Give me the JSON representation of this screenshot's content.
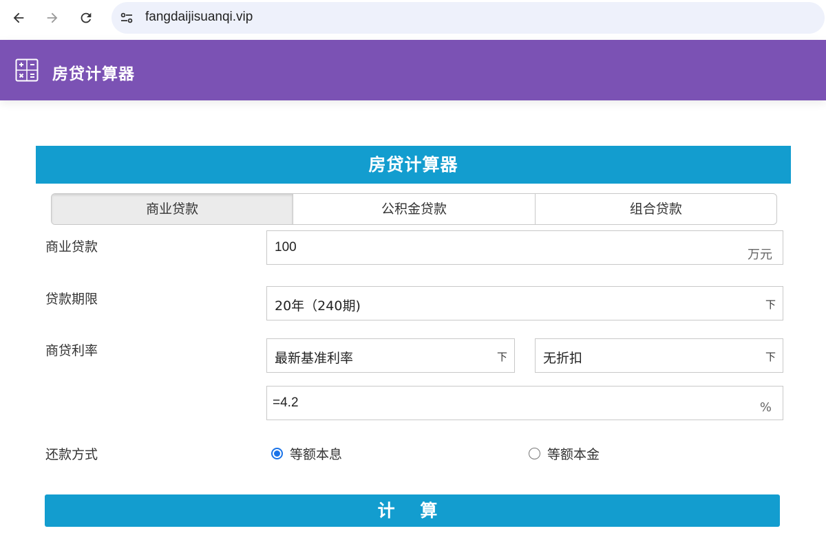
{
  "browser": {
    "url": "fangdaijisuanqi.vip"
  },
  "header": {
    "title": "房贷计算器"
  },
  "card": {
    "title": "房贷计算器"
  },
  "tabs": [
    {
      "label": "商业贷款",
      "active": true
    },
    {
      "label": "公积金贷款",
      "active": false
    },
    {
      "label": "组合贷款",
      "active": false
    }
  ],
  "form": {
    "loan_amount": {
      "label": "商业贷款",
      "value": "100",
      "unit": "万元"
    },
    "loan_term": {
      "label": "贷款期限",
      "value": "20年（240期)",
      "arrow": "下"
    },
    "rate": {
      "label": "商贷利率",
      "rate_type": {
        "value": "最新基准利率",
        "arrow": "下"
      },
      "discount": {
        "value": "无折扣",
        "arrow": "下"
      },
      "rate_value": {
        "value": "=4.2",
        "unit": "%"
      }
    },
    "repayment": {
      "label": "还款方式",
      "options": [
        {
          "label": "等额本息",
          "checked": true
        },
        {
          "label": "等额本金",
          "checked": false
        }
      ]
    }
  },
  "calculate_button": {
    "label": "计 算"
  },
  "colors": {
    "header_bg": "#7b52b4",
    "accent": "#139dcf",
    "radio_checked": "#1a73e8"
  }
}
